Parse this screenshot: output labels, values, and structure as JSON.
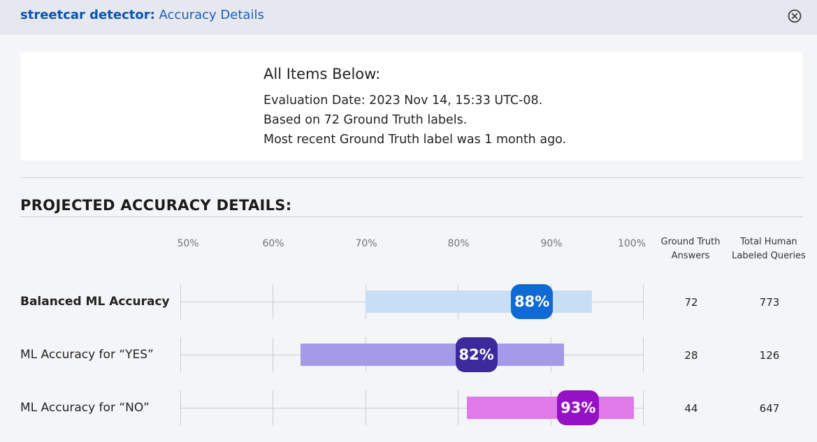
{
  "header": {
    "model_name": "streetcar detector:",
    "page_title": "Accuracy Details"
  },
  "summary": {
    "heading": "All Items Below:",
    "lines": [
      "Evaluation Date: 2023 Nov 14, 15:33 UTC-08.",
      "Based on 72 Ground Truth labels.",
      "Most recent Ground Truth label was 1 month ago."
    ]
  },
  "section_title": "PROJECTED ACCURACY DETAILS:",
  "axis": {
    "ticks": [
      "50%",
      "60%",
      "70%",
      "80%",
      "90%",
      "100%"
    ],
    "tick_values": [
      50,
      60,
      70,
      80,
      90,
      100
    ],
    "min": 50,
    "max": 100
  },
  "columns": {
    "ground_truth": [
      "Ground Truth",
      "Answers"
    ],
    "human_labeled": [
      "Total Human",
      "Labeled Queries"
    ]
  },
  "rows": [
    {
      "label": "Balanced ML Accuracy",
      "bold": true,
      "accuracy_label": "88%",
      "accuracy": 88,
      "ci_low": 70,
      "ci_high": 94.5,
      "bar_color": "#c8def5",
      "pill_color": "#0f6ad6",
      "ground_truth_answers": "72",
      "total_human_labeled": "773"
    },
    {
      "label": "ML Accuracy for “YES”",
      "bold": false,
      "accuracy_label": "82%",
      "accuracy": 82,
      "ci_low": 63,
      "ci_high": 91.5,
      "bar_color": "#a49be8",
      "pill_color": "#3c2a9c",
      "ground_truth_answers": "28",
      "total_human_labeled": "126"
    },
    {
      "label": "ML Accuracy for “NO”",
      "bold": false,
      "accuracy_label": "93%",
      "accuracy": 93,
      "ci_low": 81,
      "ci_high": 99,
      "bar_color": "#e07ae9",
      "pill_color": "#9411c4",
      "ground_truth_answers": "44",
      "total_human_labeled": "647"
    }
  ]
}
